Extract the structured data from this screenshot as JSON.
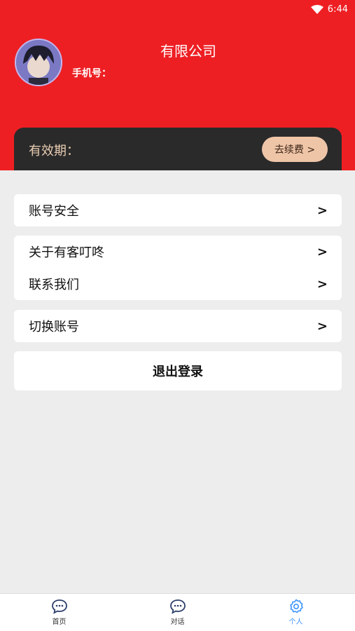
{
  "status_bar": {
    "time": "6:44"
  },
  "profile": {
    "company": "有限公司",
    "phone_label": "手机号："
  },
  "validity": {
    "label": "有效期：",
    "renew_button": "去续费 >"
  },
  "menu": {
    "group1": [
      {
        "label": "账号安全",
        "chevron": ">"
      }
    ],
    "group2": [
      {
        "label": "关于有客叮咚",
        "chevron": ">"
      },
      {
        "label": "联系我们",
        "chevron": ">"
      }
    ],
    "group3": [
      {
        "label": "切换账号",
        "chevron": ">"
      }
    ]
  },
  "logout_label": "退出登录",
  "tabs": [
    {
      "label": "首页",
      "icon": "chat-bubble-icon"
    },
    {
      "label": "对话",
      "icon": "chat-bubble-icon"
    },
    {
      "label": "个人",
      "icon": "gear-icon",
      "active": true
    }
  ],
  "colors": {
    "header": "#ee1f23",
    "card_dark": "#2a2a2a",
    "accent_peach": "#efc5a8",
    "active_tab": "#3d93ff"
  }
}
